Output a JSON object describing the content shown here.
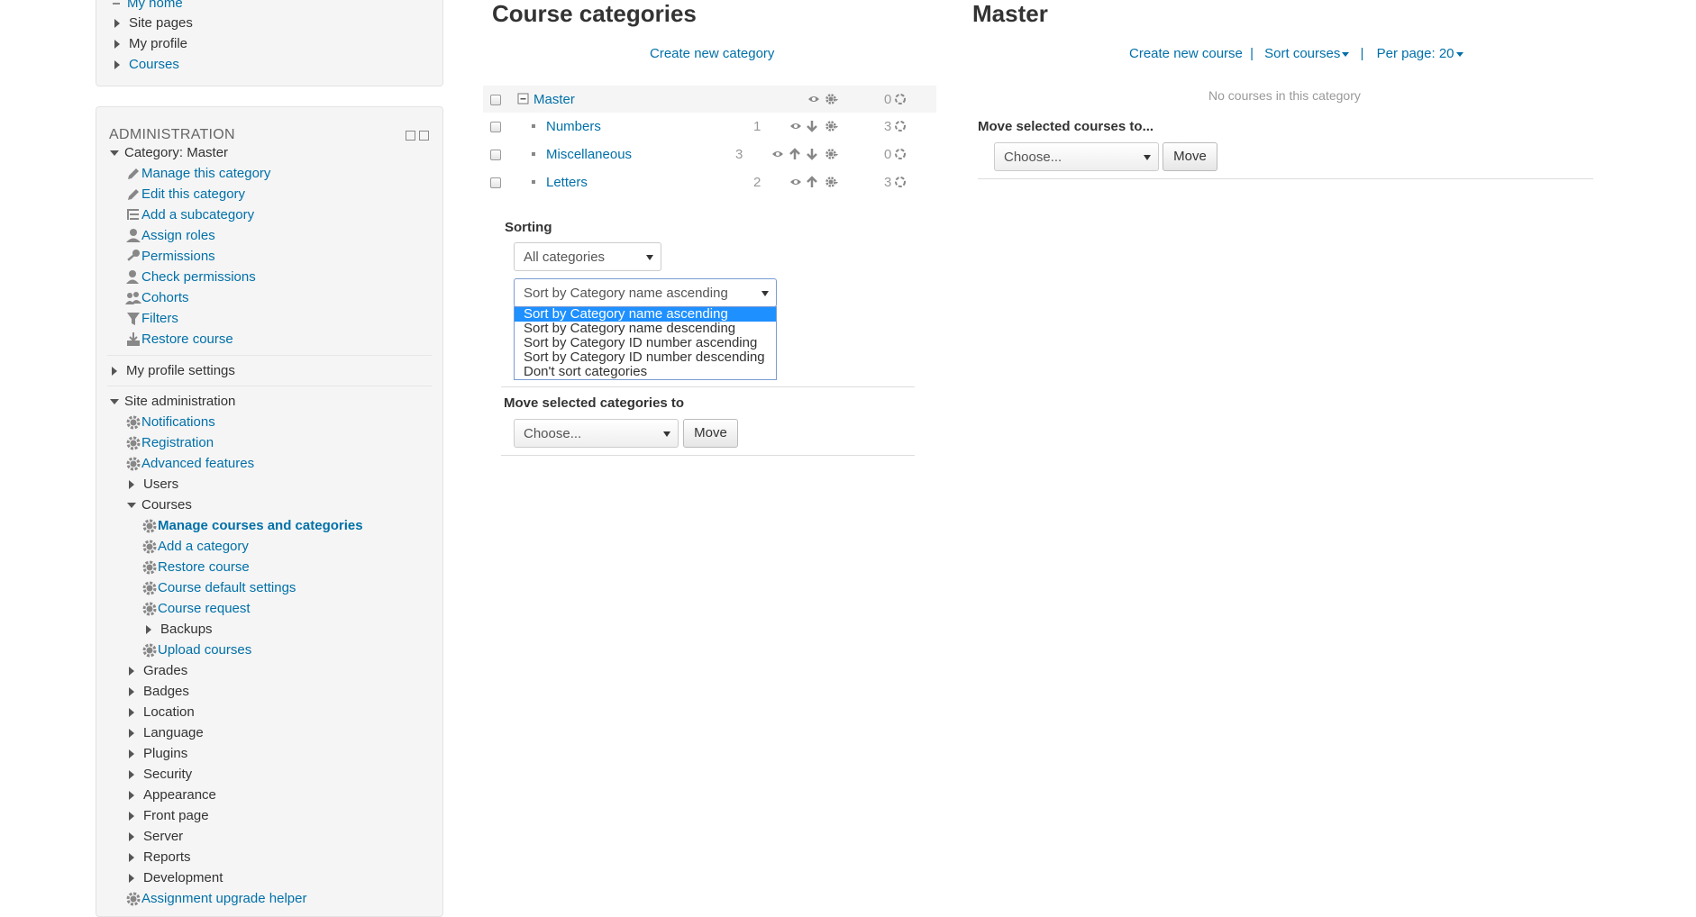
{
  "nav_block": {
    "items": [
      {
        "label": "My home"
      },
      {
        "label": "Site pages"
      },
      {
        "label": "My profile"
      },
      {
        "label": "Courses"
      }
    ]
  },
  "admin_block": {
    "title": "ADMINISTRATION",
    "category_node": "Category: Master",
    "category_items": [
      {
        "label": "Manage this category",
        "icon": "pencil-icon"
      },
      {
        "label": "Edit this category",
        "icon": "pencil-icon"
      },
      {
        "label": "Add a subcategory",
        "icon": "subcategory-icon"
      },
      {
        "label": "Assign roles",
        "icon": "user-icon"
      },
      {
        "label": "Permissions",
        "icon": "key-icon"
      },
      {
        "label": "Check permissions",
        "icon": "user-check-icon"
      },
      {
        "label": "Cohorts",
        "icon": "users-icon"
      },
      {
        "label": "Filters",
        "icon": "filter-icon"
      },
      {
        "label": "Restore course",
        "icon": "restore-icon"
      }
    ],
    "my_profile_settings": "My profile settings",
    "site_admin": "Site administration",
    "site_admin_items": [
      {
        "label": "Notifications",
        "icon": "gear-icon"
      },
      {
        "label": "Registration",
        "icon": "gear-icon"
      },
      {
        "label": "Advanced features",
        "icon": "gear-icon"
      }
    ],
    "users": "Users",
    "courses": "Courses",
    "courses_items": [
      {
        "label": "Manage courses and categories",
        "icon": "gear-icon",
        "active": true
      },
      {
        "label": "Add a category",
        "icon": "gear-icon"
      },
      {
        "label": "Restore course",
        "icon": "gear-icon"
      },
      {
        "label": "Course default settings",
        "icon": "gear-icon"
      },
      {
        "label": "Course request",
        "icon": "gear-icon"
      }
    ],
    "backups": "Backups",
    "upload_courses": "Upload courses",
    "collapsed_nodes": [
      "Grades",
      "Badges",
      "Location",
      "Language",
      "Plugins",
      "Security",
      "Appearance",
      "Front page",
      "Server",
      "Reports",
      "Development"
    ],
    "assignment_upgrade": "Assignment upgrade helper"
  },
  "categories_panel": {
    "heading": "Course categories",
    "create_new_category": "Create new category",
    "categories": [
      {
        "name": "Master",
        "subcats": "",
        "courses": "0"
      },
      {
        "name": "Numbers",
        "subcats": "1",
        "courses": "3"
      },
      {
        "name": "Miscellaneous",
        "subcats": "3",
        "courses": "0"
      },
      {
        "name": "Letters",
        "subcats": "2",
        "courses": "3"
      }
    ],
    "sorting_label": "Sorting",
    "sort_scope_selected": "All categories",
    "sort_order_selected": "Sort by Category name ascending",
    "sort_options": [
      "Sort by Category name ascending",
      "Sort by Category name descending",
      "Sort by Category ID number ascending",
      "Sort by Category ID number descending",
      "Don't sort categories"
    ],
    "move_label": "Move selected categories to",
    "move_choose": "Choose...",
    "move_button": "Move"
  },
  "courses_panel": {
    "heading": "Master",
    "create_new_course": "Create new course",
    "sep1": "|",
    "sort_courses": "Sort courses",
    "sep2": "|",
    "per_page": "Per page: 20",
    "empty_text": "No courses in this category",
    "move_label": "Move selected courses to...",
    "move_choose": "Choose...",
    "move_button": "Move"
  },
  "colors": {
    "link": "#0070a8",
    "highlight": "#1e90ff",
    "block_bg": "#f5f5f5"
  }
}
